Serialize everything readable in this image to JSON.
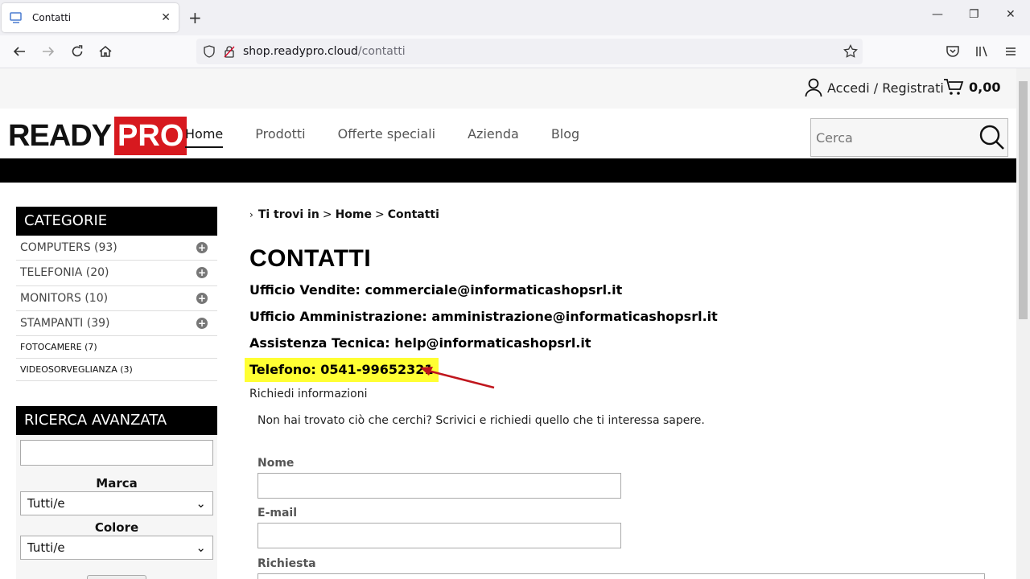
{
  "browser": {
    "tab_title": "Contatti",
    "url_domain": "shop.readypro.cloud",
    "url_path": "/contatti"
  },
  "topbar": {
    "account_label": "Accedi / Registrati",
    "cart_total": "0,00"
  },
  "header": {
    "logo_ready": "READY",
    "logo_pro": "PRO",
    "nav": [
      "Home",
      "Prodotti",
      "Offerte speciali",
      "Azienda",
      "Blog"
    ],
    "search_placeholder": "Cerca"
  },
  "sidebar": {
    "categories_title": "CATEGORIE",
    "categories": [
      {
        "label": "COMPUTERS (93)"
      },
      {
        "label": "TELEFONIA (20)"
      },
      {
        "label": "MONITORS (10)"
      },
      {
        "label": "STAMPANTI (39)"
      },
      {
        "label": "FOTOCAMERE (7)"
      },
      {
        "label": "VIDEOSORVEGLIANZA (3)"
      }
    ],
    "advanced_title": "RICERCA AVANZATA",
    "brand_label": "Marca",
    "brand_value": "Tutti/e",
    "color_label": "Colore",
    "color_value": "Tutti/e"
  },
  "main": {
    "breadcrumb_prefix": "Ti trovi in",
    "breadcrumb_sep": ">",
    "breadcrumb_home": "Home",
    "breadcrumb_current": "Contatti",
    "title": "CONTATTI",
    "sales": "Ufficio Vendite: commerciale@informaticashopsrl.it",
    "admin": "Ufficio Amministrazione: amministrazione@informaticashopsrl.it",
    "support": "Assistenza Tecnica: help@informaticashopsrl.it",
    "phone": "Telefono: 0541-99652321",
    "request_title": "Richiedi informazioni",
    "request_desc": "Non hai trovato ciò che cerchi? Scrivici e richiedi quello che ti interessa sapere.",
    "form": {
      "name_label": "Nome",
      "email_label": "E-mail",
      "request_label": "Richiesta"
    }
  },
  "colors": {
    "brand_red": "#d7191f",
    "highlight": "#ffff33",
    "arrow": "#c0161d"
  }
}
